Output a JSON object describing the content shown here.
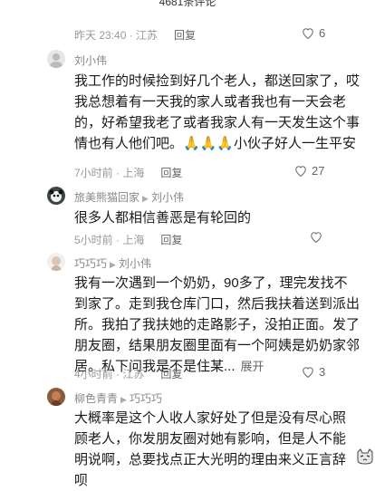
{
  "header": {
    "title": "4681条评论"
  },
  "top": {
    "meta": "昨天 23:40 · 江苏",
    "reply": "回复",
    "likes": "6"
  },
  "comments": [
    {
      "user": "刘小伟",
      "reply_to": "",
      "text": "我工作的时候捡到好几个老人，都送回家了，哎我总想着有一天我的家人或者我也有一天会老的，好希望我老了或者我家人有一天发生这个事情也有人他们吧。🙏🙏🙏小伙子好人一生平安",
      "meta": "7小时前 · 上海",
      "reply": "回复",
      "likes": "27"
    },
    {
      "user": "旅美熊猫回家",
      "reply_to": "刘小伟",
      "text": "很多人都相信善恶是有轮回的",
      "meta": "5小时前 · 上海",
      "reply": "回复",
      "likes": ""
    },
    {
      "user": "巧巧巧",
      "reply_to": "刘小伟",
      "text": "我有一次遇到一个奶奶，90多了，理完发找不到家了。走到我仓库门口，然后我扶着送到派出所。我拍了我扶她的走路影子，没拍正面。发了朋友圈，结果朋友圈里面有一个阿姨是奶奶家邻居。私下问我是不是住某...",
      "expand": "展开",
      "meta": "4小时前 · 江苏",
      "reply": "回复",
      "likes": "3"
    },
    {
      "user": "柳色青青",
      "reply_to": "巧巧巧",
      "text": "大概率是这个人收人家好处了但是没有尽心照顾老人，你发朋友圈对她有影响，但是人不能明说啊，总要找点正大光明的理由来义正言辞呗",
      "meta": "",
      "reply": "",
      "likes": ""
    }
  ],
  "icons": {
    "heart": "heart-outline-icon",
    "arrow": "triangle-right-icon",
    "cat": "cat-emoji-icon"
  }
}
